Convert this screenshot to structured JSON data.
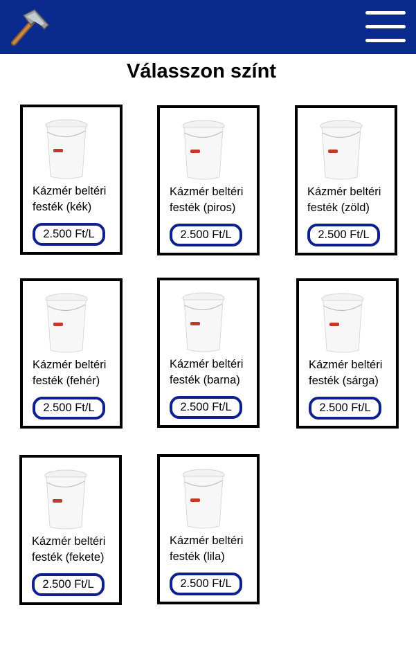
{
  "header": {
    "logo_icon": "hammer-icon",
    "menu_icon": "hamburger-menu-icon",
    "background_color": "#0a2a8e"
  },
  "page": {
    "title": "Válasszon színt"
  },
  "products": [
    {
      "name": "Kázmér beltéri festék (kék)",
      "price": "2.500 Ft/L"
    },
    {
      "name": "Kázmér beltéri festék (piros)",
      "price": "2.500 Ft/L"
    },
    {
      "name": "Kázmér beltéri festék (zöld)",
      "price": "2.500 Ft/L"
    },
    {
      "name": "Kázmér beltéri festék (fehér)",
      "price": "2.500 Ft/L"
    },
    {
      "name": "Kázmér beltéri festék (barna)",
      "price": "2.500 Ft/L"
    },
    {
      "name": "Kázmér beltéri festék (sárga)",
      "price": "2.500 Ft/L"
    },
    {
      "name": "Kázmér beltéri festék (fekete)",
      "price": "2.500 Ft/L"
    },
    {
      "name": "Kázmér beltéri festék (lila)",
      "price": "2.500 Ft/L"
    }
  ]
}
